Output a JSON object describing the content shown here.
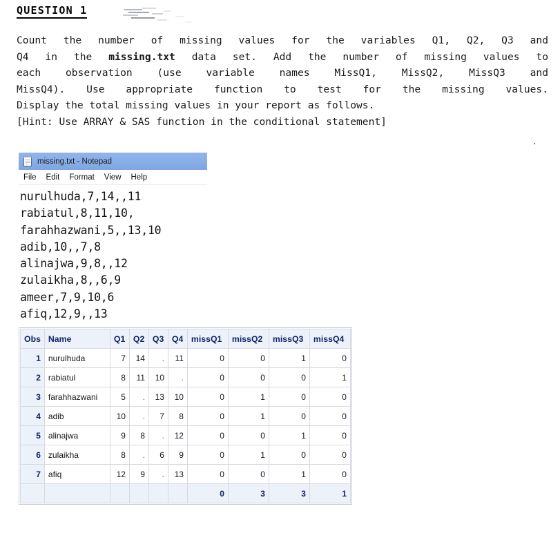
{
  "question": {
    "heading": "QUESTION 1",
    "lines": [
      "Count the number of missing values for the variables Q1, Q2, Q3 and",
      "Q4 in the ",
      "missing.txt",
      " data set.  Add the number of missing values to",
      "each observation (use variable names MissQ1, MissQ2, MissQ3 and",
      "MissQ4). Use appropriate function to test for the missing values.",
      "Display the total missing values in your report as follows.",
      "[Hint: Use ARRAY & SAS function in the conditional statement]"
    ],
    "line1": "Count the number of missing values for the variables Q1, Q2, Q3 and",
    "line2_pre": "Q4 in the ",
    "line2_bold": "missing.txt",
    "line2_post": " data set.  Add the number of missing values to",
    "line3": "each observation (use variable names MissQ1, MissQ2, MissQ3 and",
    "line4": "MissQ4). Use appropriate function to test for the missing values.",
    "line5": "Display the total missing values in your report as follows.",
    "line6": "[Hint: Use ARRAY & SAS function in the conditional statement]"
  },
  "notepad": {
    "title": "missing.txt - Notepad",
    "icon": "notepad-icon",
    "menu": [
      "File",
      "Edit",
      "Format",
      "View",
      "Help"
    ],
    "menu_file": "File",
    "menu_edit": "Edit",
    "menu_format": "Format",
    "menu_view": "View",
    "menu_help": "Help",
    "titlebar_color": "#89aee7",
    "content": [
      "nurulhuda,7,14,,11",
      "rabiatul,8,11,10,",
      "farahhazwani,5,,13,10",
      "adib,10,,7,8",
      "alinajwa,9,8,,12",
      "zulaikha,8,,6,9",
      "ameer,7,9,10,6",
      "afiq,12,9,,13"
    ],
    "line0": "nurulhuda,7,14,,11",
    "line1": "rabiatul,8,11,10,",
    "line2": "farahhazwani,5,,13,10",
    "line3": "adib,10,,7,8",
    "line4": "alinajwa,9,8,,12",
    "line5": "zulaikha,8,,6,9",
    "line6": "ameer,7,9,10,6",
    "line7": "afiq,12,9,,13"
  },
  "output_table": {
    "header_color": "#112266",
    "header_bg": "#edf2fa",
    "columns": [
      "Obs",
      "Name",
      "Q1",
      "Q2",
      "Q3",
      "Q4",
      "missQ1",
      "missQ2",
      "missQ3",
      "missQ4"
    ],
    "h_obs": "Obs",
    "h_name": "Name",
    "h_q1": "Q1",
    "h_q2": "Q2",
    "h_q3": "Q3",
    "h_q4": "Q4",
    "h_missq1": "missQ1",
    "h_missq2": "missQ2",
    "h_missq3": "missQ3",
    "h_missq4": "missQ4",
    "rows": [
      {
        "obs": "1",
        "name": "nurulhuda",
        "q1": "7",
        "q2": "14",
        "q3": ".",
        "q4": "11",
        "m1": "0",
        "m2": "0",
        "m3": "1",
        "m4": "0"
      },
      {
        "obs": "2",
        "name": "rabiatul",
        "q1": "8",
        "q2": "11",
        "q3": "10",
        "q4": ".",
        "m1": "0",
        "m2": "0",
        "m3": "0",
        "m4": "1"
      },
      {
        "obs": "3",
        "name": "farahhazwani",
        "q1": "5",
        "q2": ".",
        "q3": "13",
        "q4": "10",
        "m1": "0",
        "m2": "1",
        "m3": "0",
        "m4": "0"
      },
      {
        "obs": "4",
        "name": "adib",
        "q1": "10",
        "q2": ".",
        "q3": "7",
        "q4": "8",
        "m1": "0",
        "m2": "1",
        "m3": "0",
        "m4": "0"
      },
      {
        "obs": "5",
        "name": "alinajwa",
        "q1": "9",
        "q2": "8",
        "q3": ".",
        "q4": "12",
        "m1": "0",
        "m2": "0",
        "m3": "1",
        "m4": "0"
      },
      {
        "obs": "6",
        "name": "zulaikha",
        "q1": "8",
        "q2": ".",
        "q3": "6",
        "q4": "9",
        "m1": "0",
        "m2": "1",
        "m3": "0",
        "m4": "0"
      },
      {
        "obs": "7",
        "name": "afiq",
        "q1": "12",
        "q2": "9",
        "q3": ".",
        "q4": "13",
        "m1": "0",
        "m2": "0",
        "m3": "1",
        "m4": "0"
      }
    ],
    "totals": {
      "m1": "0",
      "m2": "3",
      "m3": "3",
      "m4": "1"
    },
    "total_m1": "0",
    "total_m2": "3",
    "total_m3": "3",
    "total_m4": "1"
  }
}
